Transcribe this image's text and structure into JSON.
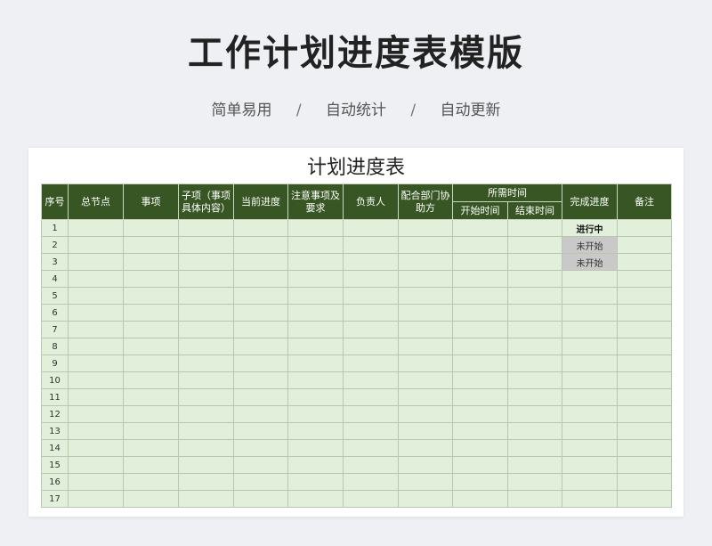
{
  "page": {
    "title": "工作计划进度表模版",
    "tags": [
      "简单易用",
      "自动统计",
      "自动更新"
    ],
    "separator": "/"
  },
  "sheet": {
    "title": "计划进度表",
    "headers": {
      "index": "序号",
      "node": "总节点",
      "item": "事项",
      "subitem": "子项（事项具体内容）",
      "current": "当前进度",
      "notes": "注意事项及要求",
      "owner": "负责人",
      "dept": "配合部门协助方",
      "time_group": "所需时间",
      "start": "开始时间",
      "end": "结束时间",
      "status": "完成进度",
      "remark": "备注"
    },
    "rows": [
      {
        "index": "1",
        "status": "进行中"
      },
      {
        "index": "2",
        "status": "未开始"
      },
      {
        "index": "3",
        "status": "未开始"
      },
      {
        "index": "4",
        "status": ""
      },
      {
        "index": "5",
        "status": ""
      },
      {
        "index": "6",
        "status": ""
      },
      {
        "index": "7",
        "status": ""
      },
      {
        "index": "8",
        "status": ""
      },
      {
        "index": "9",
        "status": ""
      },
      {
        "index": "10",
        "status": ""
      },
      {
        "index": "11",
        "status": ""
      },
      {
        "index": "12",
        "status": ""
      },
      {
        "index": "13",
        "status": ""
      },
      {
        "index": "14",
        "status": ""
      },
      {
        "index": "15",
        "status": ""
      },
      {
        "index": "16",
        "status": ""
      },
      {
        "index": "17",
        "status": ""
      }
    ],
    "colors": {
      "header": "#375623",
      "cell": "#e2efda",
      "pending": "#c9c9c9"
    }
  }
}
